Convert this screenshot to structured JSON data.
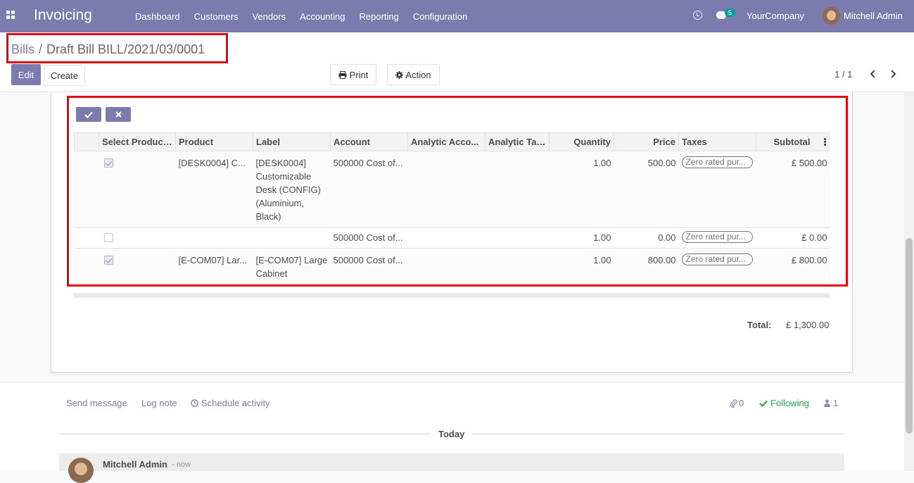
{
  "navbar": {
    "app_name": "Invoicing",
    "menu": [
      "Dashboard",
      "Customers",
      "Vendors",
      "Accounting",
      "Reporting",
      "Configuration"
    ],
    "chat_badge": "5",
    "company": "YourCompany",
    "user": "Mitchell Admin"
  },
  "breadcrumb": {
    "parent": "Bills",
    "separator": "/",
    "current": "Draft Bill BILL/2021/03/0001"
  },
  "toolbar": {
    "edit": "Edit",
    "create": "Create",
    "print": "Print",
    "action": "Action",
    "pager": "1 / 1"
  },
  "lines_table": {
    "columns": [
      "Select Product...",
      "Product",
      "Label",
      "Account",
      "Analytic Acco...",
      "Analytic Tags",
      "Quantity",
      "Price",
      "Taxes",
      "Subtotal"
    ],
    "rows": [
      {
        "selected": true,
        "product": "[DESK0004] C...",
        "label": "[DESK0004] Customizable Desk (CONFIG) (Aluminium, Black)",
        "account": "500000 Cost of...",
        "analytic_account": "",
        "analytic_tags": "",
        "quantity": "1.00",
        "price": "500.00",
        "taxes": "Zero rated pur...",
        "subtotal": "£ 500.00"
      },
      {
        "selected": false,
        "product": "",
        "label": "",
        "account": "500000 Cost of...",
        "analytic_account": "",
        "analytic_tags": "",
        "quantity": "1.00",
        "price": "0.00",
        "taxes": "Zero rated pur...",
        "subtotal": "£ 0.00"
      },
      {
        "selected": true,
        "product": "[E-COM07] Lar...",
        "label": "[E-COM07] Large Cabinet",
        "account": "500000 Cost of...",
        "analytic_account": "",
        "analytic_tags": "",
        "quantity": "1.00",
        "price": "800.00",
        "taxes": "Zero rated pur...",
        "subtotal": "£ 800.00"
      }
    ]
  },
  "totals": {
    "label": "Total:",
    "value": "£ 1,300.00"
  },
  "chatter": {
    "send_message": "Send message",
    "log_note": "Log note",
    "schedule_activity": "Schedule activity",
    "attachments": "0",
    "following": "Following",
    "followers": "1",
    "today": "Today",
    "message_author": "Mitchell Admin",
    "message_time": "- now"
  },
  "colors": {
    "brand": "#7c7bad",
    "highlight": "#e4050f",
    "following": "#28a745"
  }
}
